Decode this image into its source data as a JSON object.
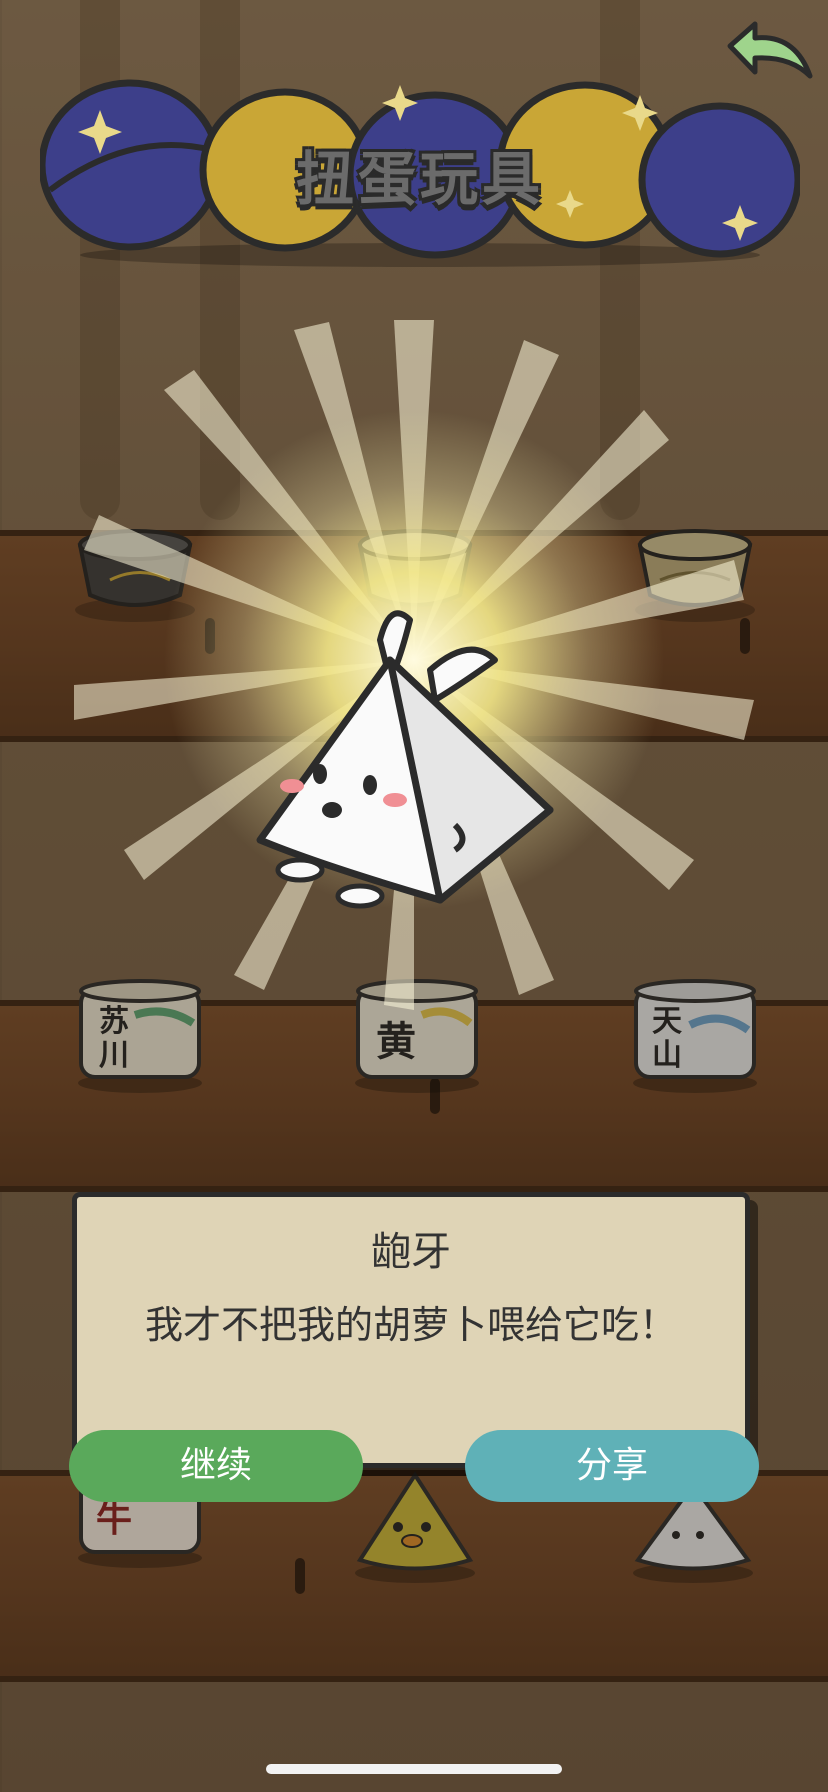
{
  "header": {
    "title": "扭蛋玩具",
    "back_icon": "back-arrow-icon"
  },
  "shelf_items": {
    "row2": [
      "苏川",
      "黄",
      "天山"
    ],
    "row3": [
      "牛"
    ]
  },
  "result": {
    "name": "龅牙",
    "message": "我才不把我的胡萝卜喂给它吃！"
  },
  "buttons": {
    "continue_label": "继续",
    "share_label": "分享"
  },
  "colors": {
    "continue": "#5aa95b",
    "share": "#5fb1b7",
    "dialog_bg": "#dfd4b6",
    "capsule_blue": "#3d3f8a",
    "capsule_yellow": "#c9a636"
  }
}
